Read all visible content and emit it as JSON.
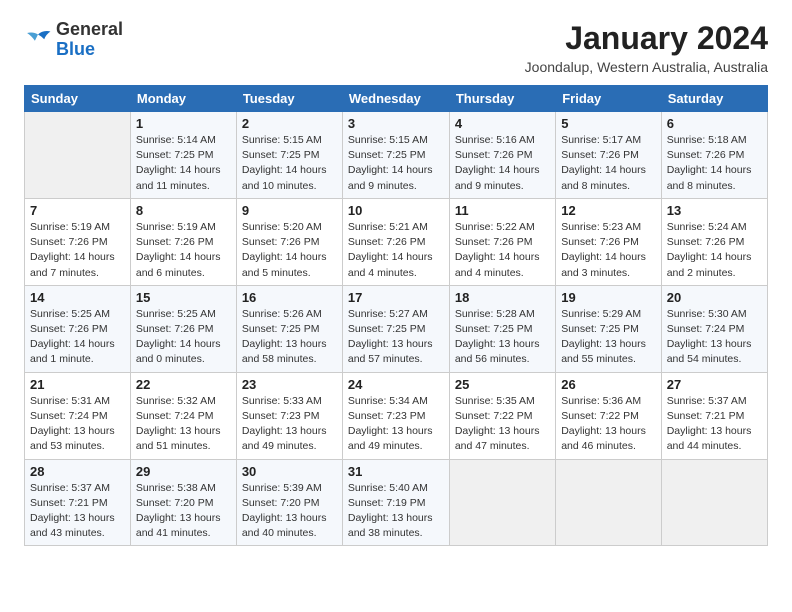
{
  "header": {
    "logo_general": "General",
    "logo_blue": "Blue",
    "month_year": "January 2024",
    "location": "Joondalup, Western Australia, Australia"
  },
  "days_of_week": [
    "Sunday",
    "Monday",
    "Tuesday",
    "Wednesday",
    "Thursday",
    "Friday",
    "Saturday"
  ],
  "weeks": [
    [
      {
        "day": "",
        "info": ""
      },
      {
        "day": "1",
        "info": "Sunrise: 5:14 AM\nSunset: 7:25 PM\nDaylight: 14 hours\nand 11 minutes."
      },
      {
        "day": "2",
        "info": "Sunrise: 5:15 AM\nSunset: 7:25 PM\nDaylight: 14 hours\nand 10 minutes."
      },
      {
        "day": "3",
        "info": "Sunrise: 5:15 AM\nSunset: 7:25 PM\nDaylight: 14 hours\nand 9 minutes."
      },
      {
        "day": "4",
        "info": "Sunrise: 5:16 AM\nSunset: 7:26 PM\nDaylight: 14 hours\nand 9 minutes."
      },
      {
        "day": "5",
        "info": "Sunrise: 5:17 AM\nSunset: 7:26 PM\nDaylight: 14 hours\nand 8 minutes."
      },
      {
        "day": "6",
        "info": "Sunrise: 5:18 AM\nSunset: 7:26 PM\nDaylight: 14 hours\nand 8 minutes."
      }
    ],
    [
      {
        "day": "7",
        "info": "Sunrise: 5:19 AM\nSunset: 7:26 PM\nDaylight: 14 hours\nand 7 minutes."
      },
      {
        "day": "8",
        "info": "Sunrise: 5:19 AM\nSunset: 7:26 PM\nDaylight: 14 hours\nand 6 minutes."
      },
      {
        "day": "9",
        "info": "Sunrise: 5:20 AM\nSunset: 7:26 PM\nDaylight: 14 hours\nand 5 minutes."
      },
      {
        "day": "10",
        "info": "Sunrise: 5:21 AM\nSunset: 7:26 PM\nDaylight: 14 hours\nand 4 minutes."
      },
      {
        "day": "11",
        "info": "Sunrise: 5:22 AM\nSunset: 7:26 PM\nDaylight: 14 hours\nand 4 minutes."
      },
      {
        "day": "12",
        "info": "Sunrise: 5:23 AM\nSunset: 7:26 PM\nDaylight: 14 hours\nand 3 minutes."
      },
      {
        "day": "13",
        "info": "Sunrise: 5:24 AM\nSunset: 7:26 PM\nDaylight: 14 hours\nand 2 minutes."
      }
    ],
    [
      {
        "day": "14",
        "info": "Sunrise: 5:25 AM\nSunset: 7:26 PM\nDaylight: 14 hours\nand 1 minute."
      },
      {
        "day": "15",
        "info": "Sunrise: 5:25 AM\nSunset: 7:26 PM\nDaylight: 14 hours\nand 0 minutes."
      },
      {
        "day": "16",
        "info": "Sunrise: 5:26 AM\nSunset: 7:25 PM\nDaylight: 13 hours\nand 58 minutes."
      },
      {
        "day": "17",
        "info": "Sunrise: 5:27 AM\nSunset: 7:25 PM\nDaylight: 13 hours\nand 57 minutes."
      },
      {
        "day": "18",
        "info": "Sunrise: 5:28 AM\nSunset: 7:25 PM\nDaylight: 13 hours\nand 56 minutes."
      },
      {
        "day": "19",
        "info": "Sunrise: 5:29 AM\nSunset: 7:25 PM\nDaylight: 13 hours\nand 55 minutes."
      },
      {
        "day": "20",
        "info": "Sunrise: 5:30 AM\nSunset: 7:24 PM\nDaylight: 13 hours\nand 54 minutes."
      }
    ],
    [
      {
        "day": "21",
        "info": "Sunrise: 5:31 AM\nSunset: 7:24 PM\nDaylight: 13 hours\nand 53 minutes."
      },
      {
        "day": "22",
        "info": "Sunrise: 5:32 AM\nSunset: 7:24 PM\nDaylight: 13 hours\nand 51 minutes."
      },
      {
        "day": "23",
        "info": "Sunrise: 5:33 AM\nSunset: 7:23 PM\nDaylight: 13 hours\nand 49 minutes."
      },
      {
        "day": "24",
        "info": "Sunrise: 5:34 AM\nSunset: 7:23 PM\nDaylight: 13 hours\nand 49 minutes."
      },
      {
        "day": "25",
        "info": "Sunrise: 5:35 AM\nSunset: 7:22 PM\nDaylight: 13 hours\nand 47 minutes."
      },
      {
        "day": "26",
        "info": "Sunrise: 5:36 AM\nSunset: 7:22 PM\nDaylight: 13 hours\nand 46 minutes."
      },
      {
        "day": "27",
        "info": "Sunrise: 5:37 AM\nSunset: 7:21 PM\nDaylight: 13 hours\nand 44 minutes."
      }
    ],
    [
      {
        "day": "28",
        "info": "Sunrise: 5:37 AM\nSunset: 7:21 PM\nDaylight: 13 hours\nand 43 minutes."
      },
      {
        "day": "29",
        "info": "Sunrise: 5:38 AM\nSunset: 7:20 PM\nDaylight: 13 hours\nand 41 minutes."
      },
      {
        "day": "30",
        "info": "Sunrise: 5:39 AM\nSunset: 7:20 PM\nDaylight: 13 hours\nand 40 minutes."
      },
      {
        "day": "31",
        "info": "Sunrise: 5:40 AM\nSunset: 7:19 PM\nDaylight: 13 hours\nand 38 minutes."
      },
      {
        "day": "",
        "info": ""
      },
      {
        "day": "",
        "info": ""
      },
      {
        "day": "",
        "info": ""
      }
    ]
  ]
}
